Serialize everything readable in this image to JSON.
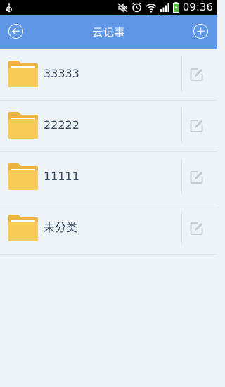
{
  "status_bar": {
    "time": "09:36",
    "icons": [
      "usb-icon",
      "mute-icon",
      "alarm-icon",
      "wifi-icon",
      "signal-icon",
      "battery-icon"
    ]
  },
  "header": {
    "title": "云记事",
    "back_icon": "back-arrow-icon",
    "add_icon": "add-icon",
    "background": "#5f96e6"
  },
  "folders": [
    {
      "name": "33333",
      "icon": "folder-icon",
      "action_icon": "edit-icon"
    },
    {
      "name": "22222",
      "icon": "folder-icon",
      "action_icon": "edit-icon"
    },
    {
      "name": "11111",
      "icon": "folder-icon",
      "action_icon": "edit-icon"
    },
    {
      "name": "未分类",
      "icon": "folder-icon",
      "action_icon": "edit-icon"
    }
  ]
}
